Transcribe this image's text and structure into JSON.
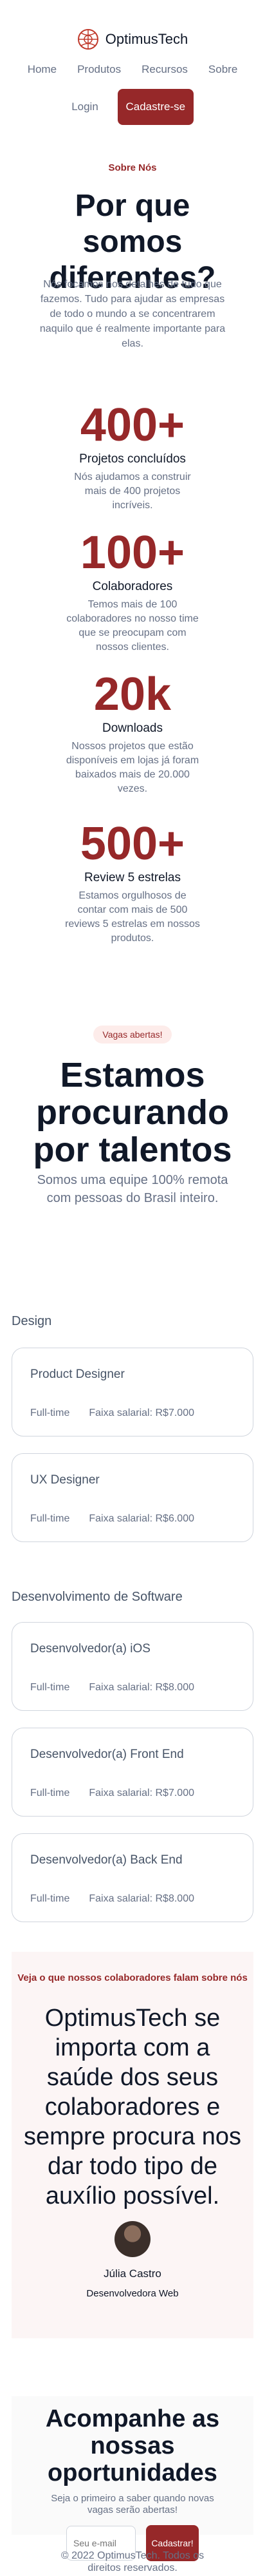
{
  "brand": {
    "name": "OptimusTech",
    "accent": "#962829"
  },
  "nav": {
    "items": [
      "Home",
      "Produtos",
      "Recursos",
      "Sobre"
    ]
  },
  "auth": {
    "login": "Login",
    "signup": "Cadastre-se"
  },
  "about": {
    "eyebrow": "Sobre Nós",
    "title": "Por que somos diferentes?",
    "description": "Nós focamos nos detalhes de tudo que fazemos. Tudo para ajudar as empresas de todo o mundo a se concentrarem naquilo que é realmente importante para elas."
  },
  "stats": [
    {
      "value": "400+",
      "label": "Projetos concluídos",
      "desc": "Nós ajudamos a construir mais de 400 projetos incríveis."
    },
    {
      "value": "100+",
      "label": "Colaboradores",
      "desc": "Temos mais de 100 colaboradores no nosso time que se preocupam com nossos clientes."
    },
    {
      "value": "20k",
      "label": "Downloads",
      "desc": "Nossos projetos que estão disponíveis em lojas já foram baixados mais de 20.000 vezes."
    },
    {
      "value": "500+",
      "label": "Review 5 estrelas",
      "desc": "Estamos orgulhosos de contar com mais de 500 reviews 5 estrelas em nossos produtos."
    }
  ],
  "careers": {
    "badge": "Vagas abertas!",
    "title": "Estamos procurando por talentos",
    "subtitle": "Somos uma equipe 100% remota com pessoas do Brasil inteiro."
  },
  "departments": [
    {
      "name": "Design",
      "jobs": [
        {
          "title": "Product Designer",
          "type": "Full-time",
          "salary": "Faixa salarial: R$7.000"
        },
        {
          "title": "UX Designer",
          "type": "Full-time",
          "salary": "Faixa salarial: R$6.000"
        }
      ]
    },
    {
      "name": "Desenvolvimento de Software",
      "jobs": [
        {
          "title": "Desenvolvedor(a) iOS",
          "type": "Full-time",
          "salary": "Faixa salarial: R$8.000"
        },
        {
          "title": "Desenvolvedor(a) Front End",
          "type": "Full-time",
          "salary": "Faixa salarial: R$7.000"
        },
        {
          "title": "Desenvolvedor(a) Back End",
          "type": "Full-time",
          "salary": "Faixa salarial: R$8.000"
        }
      ]
    }
  ],
  "testimonial": {
    "eyebrow": "Veja o que nossos colaboradores falam sobre nós",
    "quote": "OptimusTech se importa com a saúde dos seus colaboradores e sempre procura nos dar todo tipo de auxílio possível.",
    "author": "Júlia Castro",
    "role": "Desenvolvedora Web"
  },
  "subscribe": {
    "title": "Acompanhe as nossas oportunidades",
    "description": "Seja o primeiro a saber quando novas vagas serão abertas!",
    "placeholder": "Seu e-mail",
    "button": "Cadastrar!"
  },
  "footer": {
    "text": "© 2022 OptimusTech. Todos os direitos reservados."
  }
}
